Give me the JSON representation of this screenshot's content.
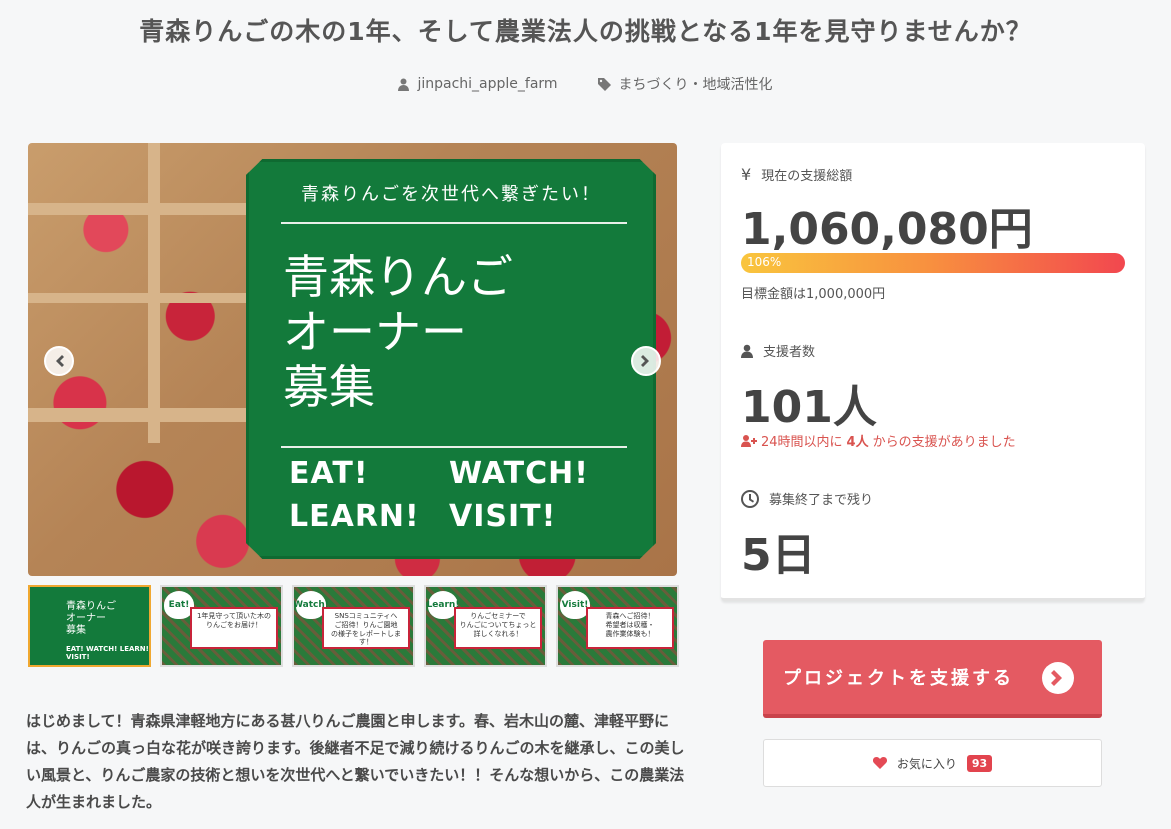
{
  "project": {
    "title": "青森りんごの木の1年、そして農業法人の挑戦となる1年を見守りませんか？",
    "owner": "jinpachi_apple_farm",
    "category": "まちづくり・地域活性化"
  },
  "hero": {
    "tagline": "青森りんごを次世代へ繋ぎたい！",
    "headline": "青森りんご\nオーナー\n募集",
    "words": [
      "EAT!",
      "WATCH!",
      "LEARN!",
      "VISIT!"
    ]
  },
  "thumbnails": [
    {
      "badge": "",
      "main": "青森りんご\nオーナー\n募集",
      "words": "EAT!  WATCH!\nLEARN!  VISIT!"
    },
    {
      "badge": "Eat!",
      "note": "1年見守って頂いた木の\nりんごをお届け！"
    },
    {
      "badge": "Watch!",
      "note": "SNSコミュニティへ\nご招待！りんご園地\nの様子をレポートします！"
    },
    {
      "badge": "Learn!",
      "note": "りんごセミナーで\nりんごについてちょっと\n詳しくなれる！"
    },
    {
      "badge": "Visit!",
      "note": "青森へご招待！\n希望者は収穫・\n農作業体験も！"
    }
  ],
  "intro": "はじめまして！青森県津軽地方にある甚八りんご農園と申します。春、岩木山の麓、津軽平野には、りんごの真っ白な花が咲き誇ります。後継者不足で減り続けるりんごの木を継承し、この美しい風景と、りんご農家の技術と想いを次世代へと繋いでいきたい！！そんな想いから、この農業法人が生まれました。",
  "stats": {
    "total_label": "現在の支援総額",
    "total_amount": "1,060,080円",
    "progress_percent": 106,
    "progress_text": "106%",
    "goal_text": "目標金額は1,000,000円",
    "supporters_label": "支援者数",
    "supporters": "101人",
    "recent_prefix": "24時間以内に",
    "recent_count": "4人",
    "recent_suffix": "からの支援がありました",
    "remaining_label": "募集終了まで残り",
    "remaining": "5日"
  },
  "actions": {
    "support_label": "プロジェクトを支援する",
    "favorite_label": "お気に入り",
    "favorite_count": "93"
  },
  "colors": {
    "accent": "#e45a62",
    "card_green": "#137a3b",
    "alert": "#d9534f"
  }
}
